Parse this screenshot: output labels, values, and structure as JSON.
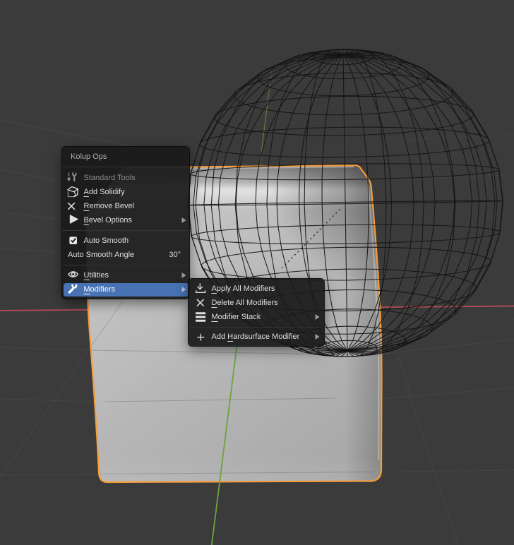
{
  "scene": {
    "type": "blender-3d-viewport",
    "colors": {
      "viewport_bg": "#3b3b3b",
      "grid_line": "#4a4a4a",
      "axis_x_red": "#ad4a52",
      "axis_y_green": "#6da33f",
      "selection_outline_orange": "#f59c3c",
      "wireframe": "#141414",
      "menu_highlight_blue": "#4772b3"
    },
    "objects": [
      "wireframe-uv-sphere",
      "selected-beveled-cube"
    ]
  },
  "context_menu": {
    "title": "Kolup Ops",
    "items": [
      {
        "label": "Standard Tools",
        "icon": "tools",
        "disabled": true
      },
      {
        "label": "Add Solidify",
        "icon": "solidify",
        "underline": 0
      },
      {
        "label": "Remove Bevel",
        "icon": "x",
        "underline": 0
      },
      {
        "label": "Bevel Options",
        "icon": "play",
        "underline": 0,
        "submenu": true
      },
      {
        "label": "Auto Smooth",
        "icon": "checkbox-checked"
      },
      {
        "label": "Auto Smooth Angle",
        "value": "30°"
      },
      {
        "label": "Utilities",
        "icon": "eye",
        "underline": 0,
        "submenu": true
      },
      {
        "label": "Modifiers",
        "icon": "wrench",
        "underline": 0,
        "submenu": true,
        "highlighted": true
      }
    ]
  },
  "submenu": {
    "items": [
      {
        "label": "Apply All Modifiers",
        "icon": "import",
        "underline": 0
      },
      {
        "label": "Delete All Modifiers",
        "icon": "x",
        "underline": 0
      },
      {
        "label": "Modifier Stack",
        "icon": "stack",
        "underline": 0,
        "submenu": true
      },
      {
        "label": "Add Hardsurface Modifier",
        "icon": "plus",
        "underline": 4,
        "submenu": true
      }
    ]
  }
}
